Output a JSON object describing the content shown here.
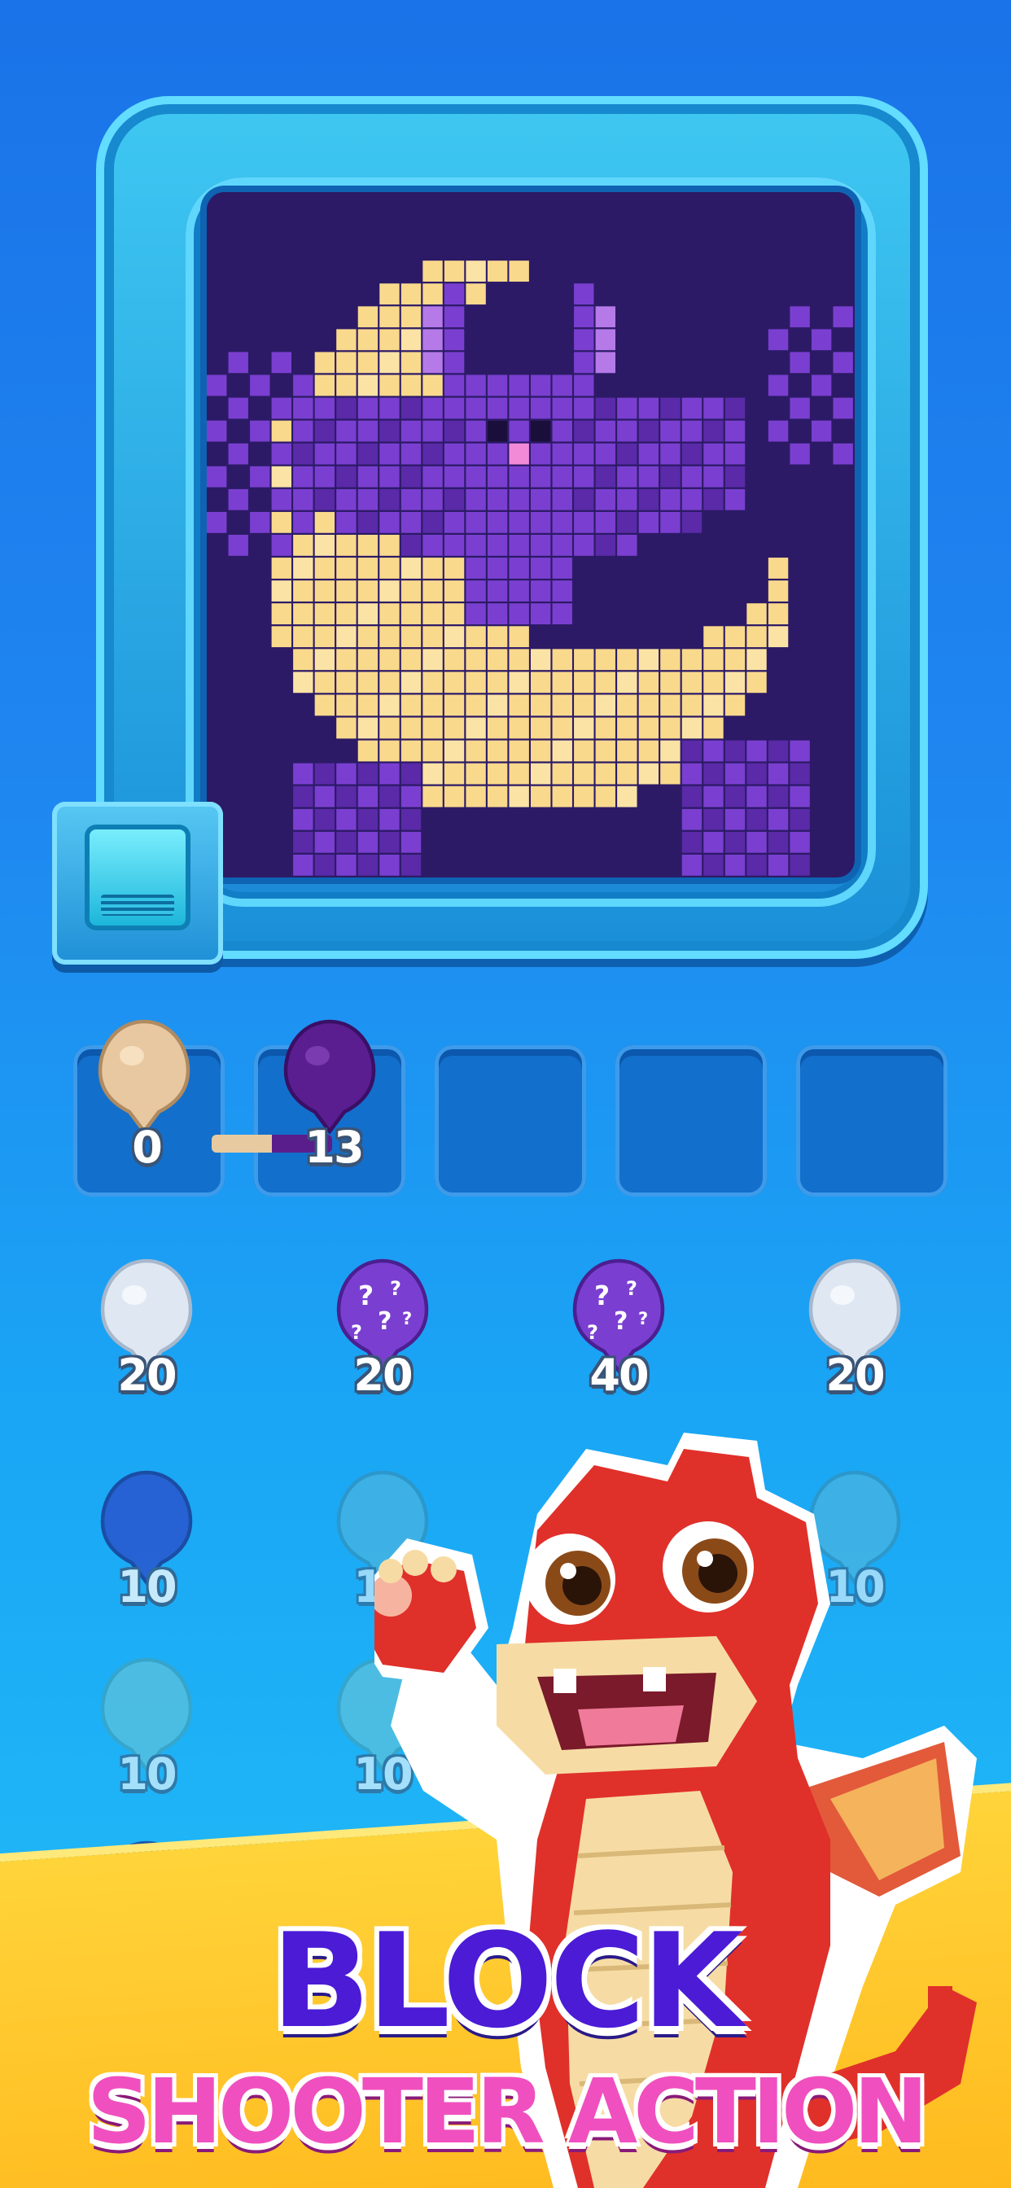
{
  "title": {
    "line1": "BLOCK",
    "line2": "SHOOTER ACTION"
  },
  "colors": {
    "background_top": "#1a73e8",
    "background_bottom": "#22c0f7",
    "board_bg": "#2c1a66",
    "moon": "#f9d98c",
    "bat": "#7a3fd0",
    "title_line1": "#4b1bd6",
    "title_line2": "#f04fbf",
    "band": "#ffc62a"
  },
  "board": {
    "subject": "pixel bat over crescent moon"
  },
  "queue": {
    "slots": [
      {
        "color": "#e8c8a0",
        "count": "0"
      },
      {
        "color": "#5b1e90",
        "count": "13"
      },
      {
        "color": "",
        "count": ""
      },
      {
        "color": "",
        "count": ""
      },
      {
        "color": "",
        "count": ""
      }
    ]
  },
  "shooters": {
    "row1": [
      {
        "color": "#dfe8f2",
        "count": "20",
        "mystery": false
      },
      {
        "color": "#7a3fd0",
        "count": "20",
        "mystery": true
      },
      {
        "color": "#7a3fd0",
        "count": "40",
        "mystery": true
      },
      {
        "color": "#dfe8f2",
        "count": "20",
        "mystery": false
      }
    ],
    "row2": [
      {
        "color": "#2a4bc8",
        "count": "10",
        "mystery": false
      },
      {
        "color": "#5ab8d8",
        "count": "10",
        "mystery": false
      },
      {
        "color": "#5ab8d8",
        "count": "10",
        "mystery": false
      }
    ],
    "row3": [
      {
        "color": "#6cc6d6",
        "count": "10",
        "mystery": false
      },
      {
        "color": "#6cc6d6",
        "count": "10",
        "mystery": false
      }
    ]
  }
}
